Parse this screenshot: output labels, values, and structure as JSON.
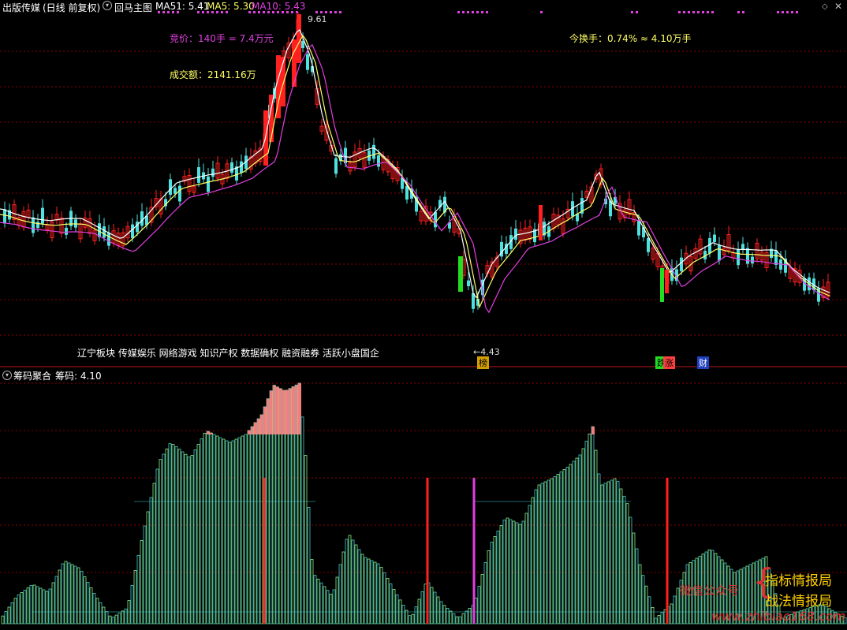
{
  "header": {
    "stock": "出版传媒",
    "period": "(日线 前复权)",
    "template": "回马主图",
    "ma51": "MA51: 5.41",
    "ma5": "MA5: 5.30",
    "ma10": "MA10: 5.43"
  },
  "annotations": {
    "auction": "竞价：140手 = 7.4万元",
    "turnover": "今换手：0.74% ≈ 4.10万手",
    "amount": "成交额：2141.16万",
    "high": "9.61",
    "low": "←4.43",
    "sectors": "辽宁板块 传媒娱乐 网络游戏 知识产权 数据确权  融资融券 活跃小盘国企",
    "tag_bang": "榜",
    "tag_die": "跌",
    "tag_zhang": "涨",
    "tag_cai": "财"
  },
  "sub": {
    "title": "筹码聚合",
    "value": "筹码: 4.10"
  },
  "watermark": {
    "wechat": "微信公众号",
    "line1": "指标情报局",
    "line2": "战法情报局",
    "url": "www.zhibiao168.com"
  },
  "colors": {
    "up": "#ff2020",
    "down": "#4fe0e0",
    "ma5": "#ffffff",
    "ma10": "#ffff66",
    "ma51": "#e040e0",
    "bull_volume": "#ff2020",
    "bear_volume": "#22dd22",
    "chip_top": "#f08080",
    "chip_green": "#88ee88",
    "chip_cyan": "#44cccc",
    "grid": "#8b0000"
  }
}
